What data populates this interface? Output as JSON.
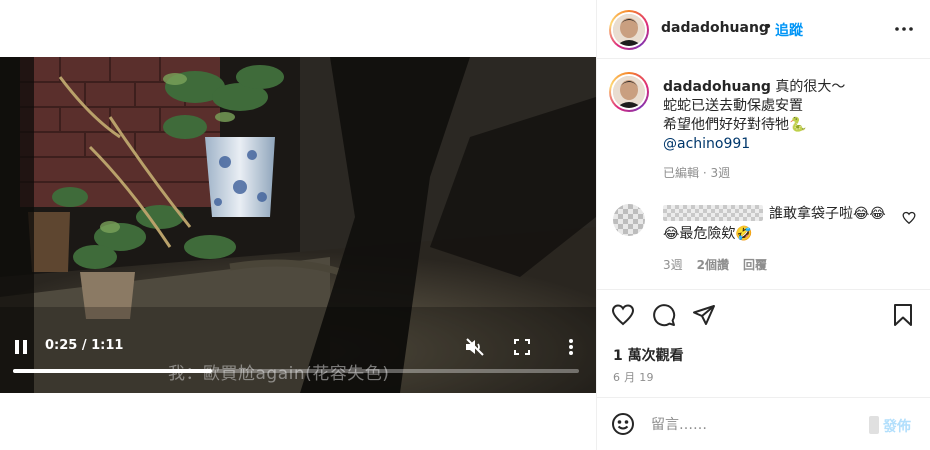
{
  "video": {
    "subtitle": "我：歐買尬again(花容失色)",
    "current_time": "0:25",
    "duration": "1:11",
    "time_display": "0:25 / 1:11",
    "progress_fraction": 0.352,
    "icons": {
      "play_pause": "pause-icon",
      "mute": "volume-muted-icon",
      "fullscreen": "fullscreen-icon",
      "more": "more-vertical-icon"
    }
  },
  "header": {
    "username": "dadadohuang",
    "separator": "•",
    "follow_label": "追蹤",
    "more_icon": "more-horizontal-icon"
  },
  "caption": {
    "username": "dadadohuang",
    "line1": "真的很大～",
    "line2": "蛇蛇已送去動保處安置",
    "line3": "希望他們好好對待牠🐍",
    "mention": "@achino991",
    "meta": "已編輯 · 3週"
  },
  "comment": {
    "text": "誰敢拿袋子啦😂😂😂最危險欸🤣",
    "age": "3週",
    "likes": "2個讚",
    "reply_label": "回覆"
  },
  "actions": {
    "views": "1 萬次觀看",
    "date": "6 月 19"
  },
  "comment_box": {
    "placeholder": "留言……",
    "post_label": "發佈"
  },
  "colors": {
    "accent_blue": "#0095f6",
    "post_disabled": "#b2dffc",
    "muted_text": "#8e8e8e",
    "text": "#262626",
    "divider": "#efefef"
  }
}
